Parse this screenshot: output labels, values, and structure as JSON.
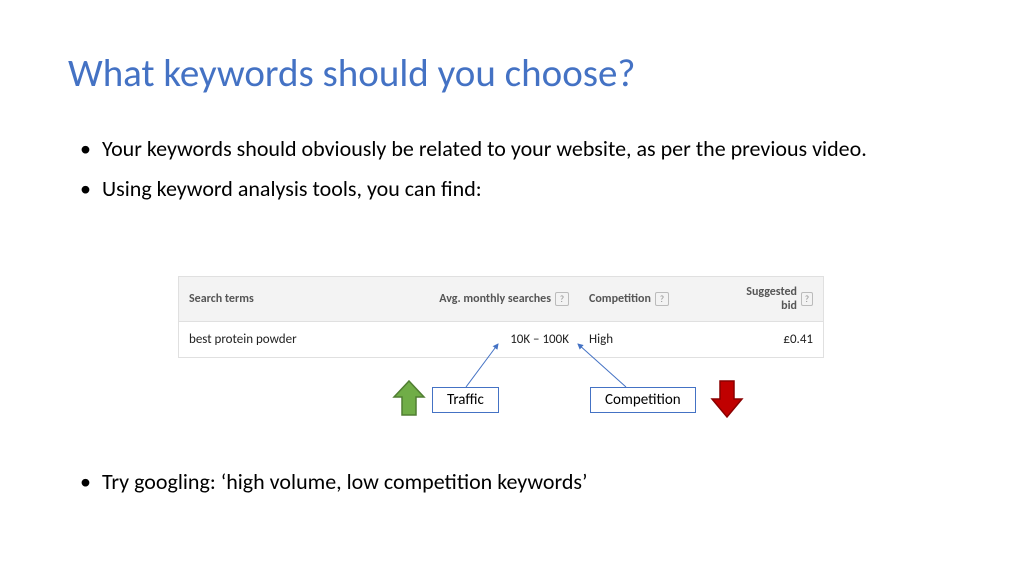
{
  "title": "What keywords should you choose?",
  "bullets": {
    "b1": "Your keywords should obviously be related to your website, as per the previous video.",
    "b2": "Using keyword analysis tools, you can find:",
    "b3": "Try googling: ‘high volume, low competition keywords’"
  },
  "table": {
    "headers": {
      "search_terms": "Search terms",
      "avg_monthly": "Avg. monthly searches",
      "competition": "Competition",
      "suggested_bid": "Suggested bid"
    },
    "row": {
      "term": "best protein powder",
      "searches": "10K – 100K",
      "competition": "High",
      "bid": "£0.41"
    }
  },
  "callouts": {
    "traffic": "Traffic",
    "competition": "Competition"
  }
}
